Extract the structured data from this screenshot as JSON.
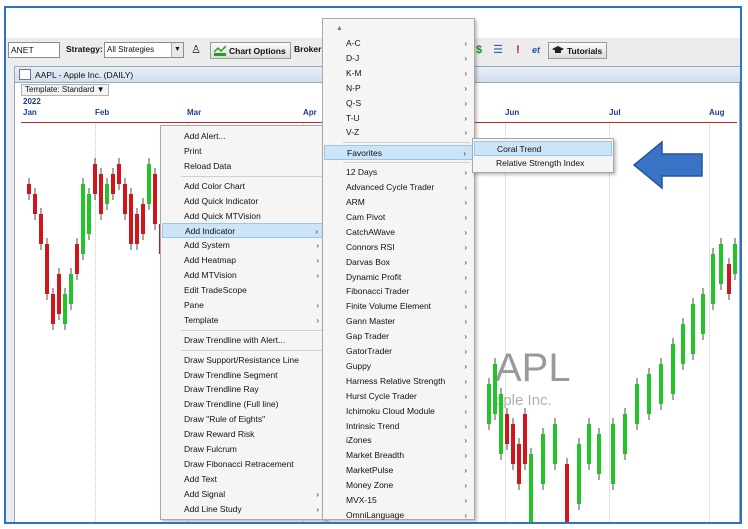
{
  "toolbar": {
    "symbol_value": "ANET",
    "strategy_label": "Strategy:",
    "strategy_value": "All Strategies",
    "chart_options_label": "Chart Options",
    "broker_label": "Broker:",
    "tutorials_label": "Tutorials",
    "icons": [
      "strategy-person-icon",
      "dollar-icon",
      "list-icon",
      "alert-exclamation-icon",
      "et-icon",
      "graduation-cap-icon"
    ]
  },
  "chart": {
    "title": "AAPL - Apple Inc. (DAILY)",
    "template_label": "Template: Standard",
    "year": "2022",
    "months": [
      "Jan",
      "Feb",
      "Mar",
      "Apr",
      "Jun",
      "Jul",
      "Aug"
    ],
    "watermark_symbol": "APL",
    "watermark_name": "pple Inc."
  },
  "context_menu": {
    "items": [
      {
        "label": "Add Alert...",
        "submenu": false
      },
      {
        "label": "Print",
        "submenu": false
      },
      {
        "label": "Reload Data",
        "submenu": false
      },
      {
        "label": "Add Color Chart",
        "submenu": false
      },
      {
        "label": "Add Quick Indicator",
        "submenu": false
      },
      {
        "label": "Add Quick MTVision",
        "submenu": false
      },
      {
        "label": "Add Indicator",
        "submenu": true,
        "highlighted": true
      },
      {
        "label": "Add System",
        "submenu": true
      },
      {
        "label": "Add Heatmap",
        "submenu": true
      },
      {
        "label": "Add MTVision",
        "submenu": true
      },
      {
        "label": "Edit TradeScope",
        "submenu": false
      },
      {
        "label": "Pane",
        "submenu": true
      },
      {
        "label": "Template",
        "submenu": true
      },
      {
        "label": "Draw Trendline with Alert...",
        "submenu": false
      },
      {
        "label": "Draw Support/Resistance Line",
        "submenu": false
      },
      {
        "label": "Draw Trendline Segment",
        "submenu": false
      },
      {
        "label": "Draw Trendline Ray",
        "submenu": false
      },
      {
        "label": "Draw Trendline (Full line)",
        "submenu": false
      },
      {
        "label": "Draw \"Rule of Eights\"",
        "submenu": false
      },
      {
        "label": "Draw Reward Risk",
        "submenu": false
      },
      {
        "label": "Draw Fulcrum",
        "submenu": false
      },
      {
        "label": "Draw Fibonacci Retracement",
        "submenu": false
      },
      {
        "label": "Add Text",
        "submenu": false
      },
      {
        "label": "Add Signal",
        "submenu": true
      },
      {
        "label": "Add Line Study",
        "submenu": true
      }
    ]
  },
  "indicator_menu": {
    "scroll_up": "▲",
    "items": [
      "A-C",
      "D-J",
      "K-M",
      "N-P",
      "Q-S",
      "T-U",
      "V-Z",
      "Favorites",
      "12 Days",
      "Advanced Cycle Trader",
      "ARM",
      "Cam Pivot",
      "CatchAWave",
      "Connors RSI",
      "Darvas Box",
      "Dynamic Profit",
      "Fibonacci Trader",
      "Finite Volume Element",
      "Gann Master",
      "Gap Trader",
      "GatorTrader",
      "Guppy",
      "Harness Relative Strength",
      "Hurst Cycle Trader",
      "Ichimoku Cloud Module",
      "Intrinsic Trend",
      "iZones",
      "Market Breadth",
      "MarketPulse",
      "Money Zone",
      "MVX-15",
      "OmniLanguage"
    ],
    "highlighted": "Favorites"
  },
  "favorites_menu": {
    "items": [
      "Coral Trend",
      "Relative Strength Index"
    ],
    "highlighted": "Coral Trend"
  },
  "colors": {
    "frame": "#2a74c8",
    "arrow": "#3a73c6",
    "up_candle": "#22c42a",
    "down_candle": "#d0161b",
    "menu_highlight": "#cce4f7"
  }
}
